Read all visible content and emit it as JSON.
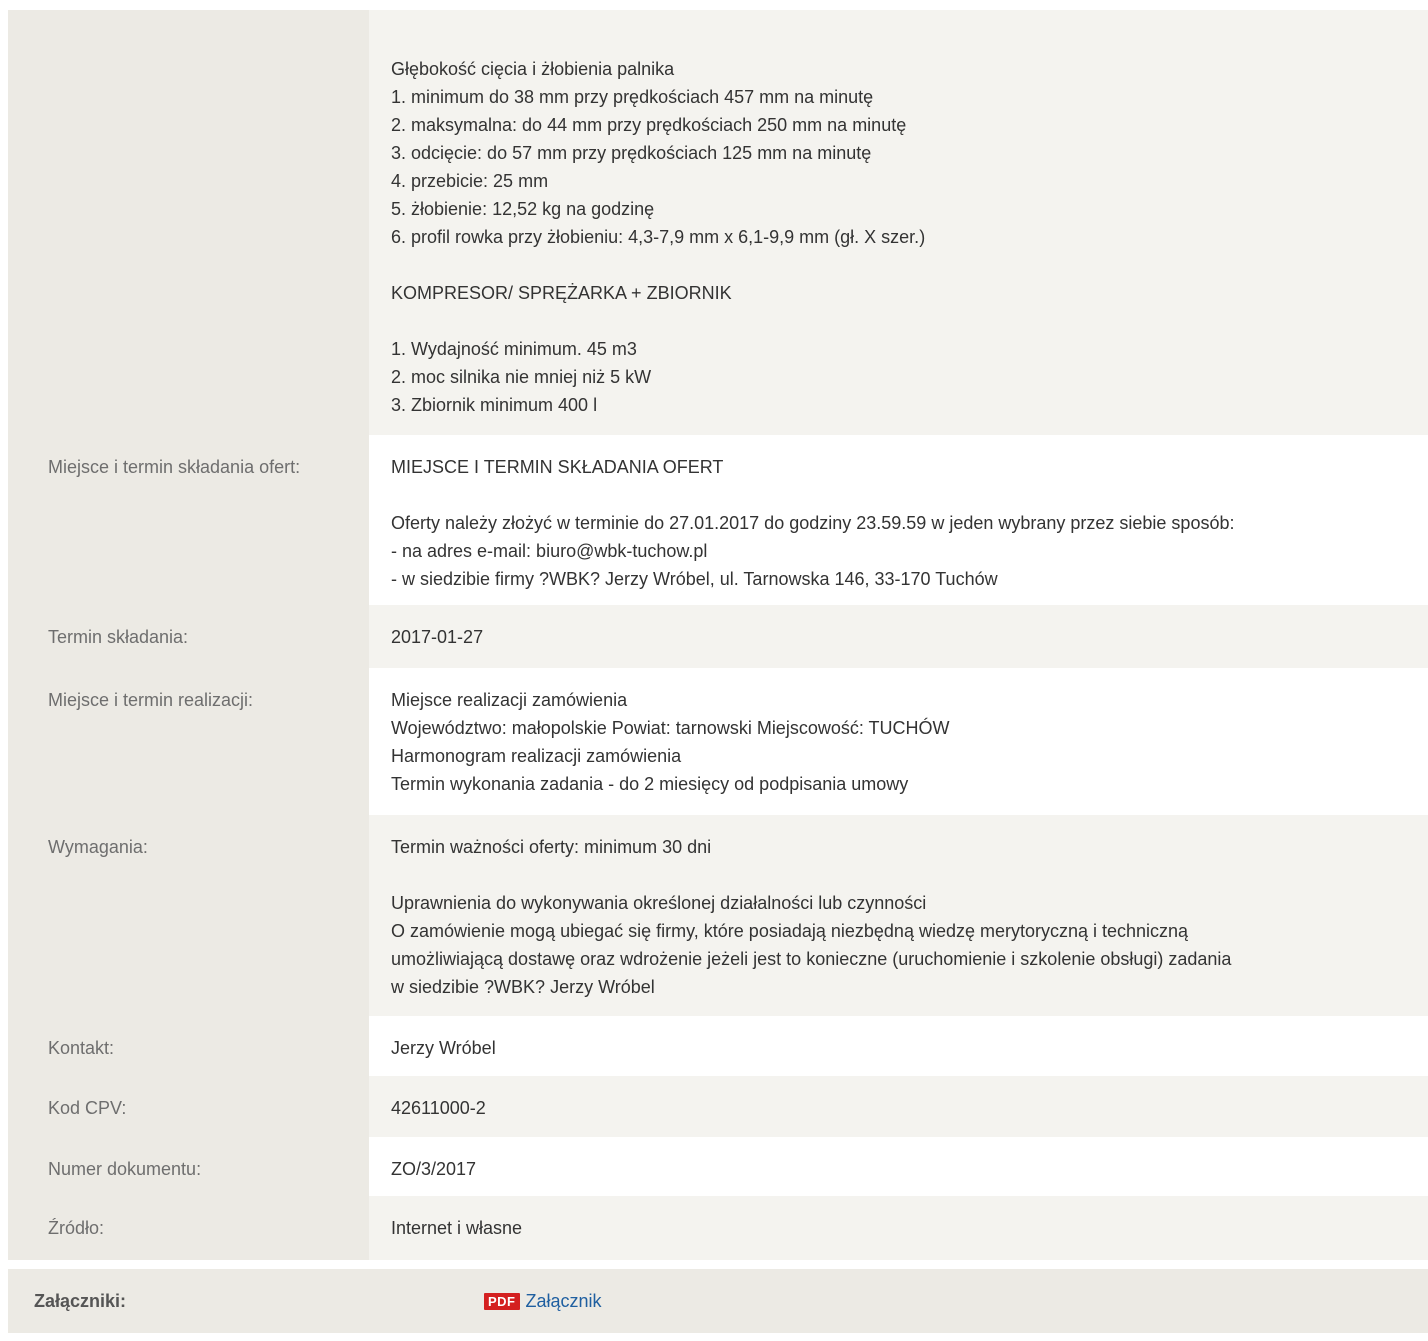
{
  "rows": [
    {
      "label": "",
      "value": "Głębokość cięcia i żłobienia palnika\n1. minimum do 38 mm przy prędkościach 457 mm na minutę\n2. maksymalna: do 44 mm przy prędkościach 250 mm na minutę\n3. odcięcie: do 57 mm przy prędkościach 125 mm na minutę\n4. przebicie: 25 mm\n5. żłobienie: 12,52 kg na godzinę\n6. profil rowka przy żłobieniu: 4,3-7,9 mm x 6,1-9,9 mm (gł. X szer.)\n\nKOMPRESOR/ SPRĘŻARKA + ZBIORNIK\n\n1. Wydajność minimum. 45 m3\n2. moc silnika nie mniej niż 5 kW\n3. Zbiornik minimum 400 l"
    },
    {
      "label": "Miejsce i termin składania ofert:",
      "value": "MIEJSCE I TERMIN SKŁADANIA OFERT\n\nOferty należy złożyć w terminie do 27.01.2017 do godziny 23.59.59 w jeden wybrany przez siebie sposób:\n- na adres e-mail: biuro@wbk-tuchow.pl\n- w siedzibie firmy ?WBK? Jerzy Wróbel, ul. Tarnowska 146, 33-170 Tuchów"
    },
    {
      "label": "Termin składania:",
      "value": "2017-01-27"
    },
    {
      "label": "Miejsce i termin realizacji:",
      "value": "Miejsce realizacji zamówienia\nWojewództwo: małopolskie Powiat: tarnowski Miejscowość: TUCHÓW\nHarmonogram realizacji zamówienia\nTermin wykonania zadania - do 2 miesięcy od podpisania umowy"
    },
    {
      "label": "Wymagania:",
      "value": "Termin ważności oferty: minimum 30 dni\n\nUprawnienia do wykonywania określonej działalności lub czynności\nO zamówienie mogą ubiegać się firmy, które posiadają niezbędną wiedzę merytoryczną i techniczną\numożliwiającą dostawę oraz wdrożenie jeżeli jest to konieczne (uruchomienie i szkolenie obsługi) zadania\nw siedzibie ?WBK? Jerzy Wróbel"
    },
    {
      "label": "Kontakt:",
      "value": "Jerzy Wróbel"
    },
    {
      "label": "Kod CPV:",
      "value": "42611000-2"
    },
    {
      "label": "Numer dokumentu:",
      "value": "ZO/3/2017"
    },
    {
      "label": "Źródło:",
      "value": "Internet i własne"
    }
  ],
  "attachments": {
    "label": "Załączniki:",
    "icon_text": "PDF",
    "link_text": "Załącznik"
  }
}
